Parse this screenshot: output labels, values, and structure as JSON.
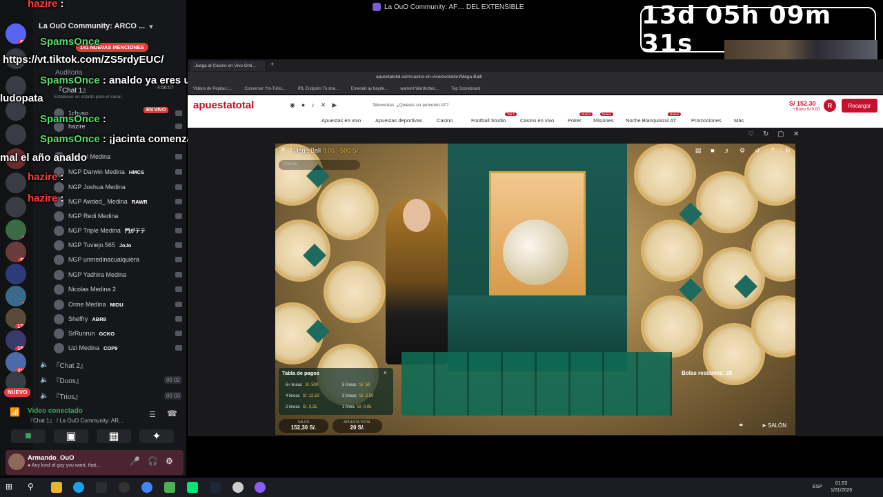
{
  "window_title": "La OuO Community: AF… DEL EXTENSIBLE",
  "timer": "13d 05h 09m 31s",
  "discord": {
    "server_name": "La OuO Community: ARCO ...",
    "mentions_badge": "141 NUEVAS MENCIONES",
    "nuevo_badge": "NUEVO",
    "server_badges": [
      "61",
      "2",
      "27",
      "9",
      "179",
      "180",
      "215"
    ],
    "channels": {
      "auditoria": "Auditoria",
      "auditoria_time": "4:56:07",
      "chat1": "『Chat 1』",
      "status_prompt": "Establece un estado para el canal",
      "live_label": "EN VIVO",
      "chat2": "『Chat 2』",
      "duos": "『Duos』",
      "trios": "『Trios』",
      "duos_count": "00  02",
      "trios_count": "00  03"
    },
    "members": [
      {
        "name": "1chuso"
      },
      {
        "name": "hazire"
      },
      {
        "name": "Gabriel Medina"
      },
      {
        "name": "NGP Darwin Medina",
        "tag": "HMCS"
      },
      {
        "name": "NGP Joshua Medina"
      },
      {
        "name": "NGP Awded_ Medina",
        "tag": "RAWR"
      },
      {
        "name": "NGP Redi Medina"
      },
      {
        "name": "NGP Triple Medina",
        "tag": "門がテテ"
      },
      {
        "name": "NGP Tuviejo.565",
        "tag": "JoJo"
      },
      {
        "name": "NGP unmedinacualquiera"
      },
      {
        "name": "NGP Yadhira Medina"
      },
      {
        "name": "Nicolas Medina 2"
      },
      {
        "name": "Orme Medina",
        "tag": "MIDU"
      },
      {
        "name": "Sheffry",
        "tag": "ABR8"
      },
      {
        "name": "SrRunrun",
        "tag": "GCKO"
      },
      {
        "name": "Uzi Medina",
        "tag": "COP9"
      }
    ],
    "voice_connected": "Video conectado",
    "voice_sub": "『Chat 1』 / La OuO Community: AR...",
    "username": "Armando_OuO",
    "user_status": "● Any kind of guy you want, that..."
  },
  "stream_chat": [
    {
      "nick": "hazire",
      "text": ":",
      "style": "red"
    },
    {
      "nick": "SpamsOnce",
      "text": ""
    },
    {
      "nick": "",
      "text": "https://vt.tiktok.com/ZS5rdyEUC/"
    },
    {
      "nick": "SpamsOnce",
      "text": ": analdo ya eres un"
    },
    {
      "nick": "",
      "text": "ludopata"
    },
    {
      "nick": "SpamsOnce",
      "text": ":"
    },
    {
      "nick": "SpamsOnce",
      "text": ": ¡jacinta comenzamos"
    },
    {
      "nick": "",
      "text": "mal el año analdo"
    },
    {
      "nick": "hazire",
      "text": ":",
      "style": "red"
    },
    {
      "nick": "hazire",
      "text": ":",
      "style": "red"
    }
  ],
  "browser": {
    "tab_title": "Juega al Casino en Vivo Onli...",
    "url": "apuestatotal.com/casino-en-vivo/evolution/Mega-Ball/",
    "bookmarks": [
      "Videos de Pepitas |...",
      "Conversor Yts-Tuhis...",
      "IRL Endpoint To stre...",
      "Emerald ay bayde...",
      "warrent Wardrobes...",
      "Top Scoreboard"
    ]
  },
  "site": {
    "logo": "apuestatotal",
    "promo": "Televentas: ¿Quieres un aumento AT?",
    "nav": [
      "Apuestas en vivo",
      "Apuestas deportivas",
      "Casino",
      "Football Studio",
      "Casino en vivo",
      "Poker",
      "Misiones",
      "Noche Blanquiazul AT",
      "Promociones",
      "Más"
    ],
    "nav_badges": {
      "football": "Top 1",
      "poker": "Nuevo",
      "misiones": "Nuevo",
      "noche": "Nuevo"
    },
    "balance": "S/ 152.30",
    "bonus": "• Bono S/ 0.00",
    "avatar_letter": "R",
    "recargar": "Recargar"
  },
  "game": {
    "title": "Mega Ball",
    "range": "0.05 - 500 S/.",
    "chat_placeholder": "Chatear",
    "paytable_title": "Tabla de pagos",
    "paytable": [
      {
        "label": "6+ lineas",
        "value": "S/. 500"
      },
      {
        "label": "5 lineas",
        "value": "S/. 50"
      },
      {
        "label": "4 lineas",
        "value": "S/. 12,50"
      },
      {
        "label": "3 lineas",
        "value": "S/. 2,50"
      },
      {
        "label": "2 lineas",
        "value": "S/. 0,25"
      },
      {
        "label": "1 linea",
        "value": "S/. 0,05"
      }
    ],
    "saldo_label": "SALDO",
    "saldo_value": "152,30 S/.",
    "apuesta_label": "APUESTA TOTAL",
    "apuesta_value": "20 S/.",
    "bolas": "Bolas restantes: 20",
    "salon": "SALÓN"
  },
  "taskbar": {
    "lang": "ESP",
    "time": "01:53",
    "date": "1/01/2026"
  }
}
